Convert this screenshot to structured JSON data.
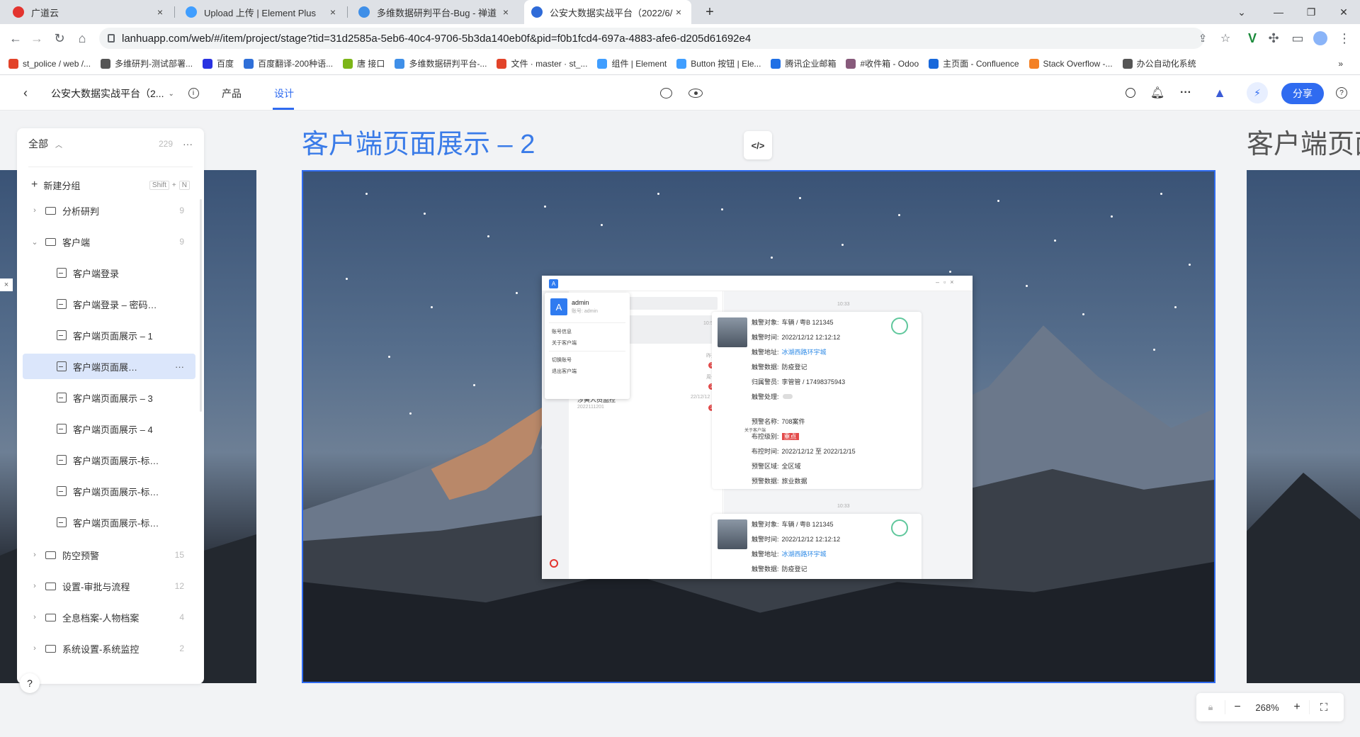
{
  "browser": {
    "tabs": [
      {
        "title": "广道云",
        "color": "#e3342f"
      },
      {
        "title": "Upload 上传 | Element Plus",
        "color": "#409eff"
      },
      {
        "title": "多维数据研判平台-Bug - 禅道",
        "color": "#3f8fe8"
      },
      {
        "title": "公安大数据实战平台（2022/6/1…",
        "color": "#2f6bd8"
      }
    ],
    "new_tab": "+",
    "url": "lanhuapp.com/web/#/item/project/stage?tid=31d2585a-5eb6-40c4-9706-5b3da140eb0f&pid=f0b1fcd4-697a-4883-afe6-d205d61692e4",
    "bookmarks": [
      {
        "label": "st_police / web /...",
        "color": "#e24329"
      },
      {
        "label": "多维研判-测试部署...",
        "color": "#555555"
      },
      {
        "label": "百度",
        "color": "#2932e1"
      },
      {
        "label": "百度翻译-200种语...",
        "color": "#2f6fd8"
      },
      {
        "label": "唐 接口",
        "color": "#7cb518"
      },
      {
        "label": "多维数据研判平台-...",
        "color": "#3f8fe8"
      },
      {
        "label": "文件 · master · st_...",
        "color": "#e24329"
      },
      {
        "label": "组件 | Element",
        "color": "#409eff"
      },
      {
        "label": "Button 按钮 | Ele...",
        "color": "#409eff"
      },
      {
        "label": "腾讯企业邮箱",
        "color": "#1f6fe5"
      },
      {
        "label": "#收件箱 - Odoo",
        "color": "#875a7b"
      },
      {
        "label": "主页面 - Confluence",
        "color": "#1868db"
      },
      {
        "label": "Stack Overflow -...",
        "color": "#f48024"
      },
      {
        "label": "办公自动化系统",
        "color": "#555555"
      }
    ],
    "more_bookmarks": "»"
  },
  "header": {
    "project_name": "公安大数据实战平台（2...",
    "tabs": [
      "产品",
      "设计"
    ],
    "active_tab": "设计",
    "share_label": "分享",
    "accent": "#2f6bf0"
  },
  "sidebar": {
    "filter_label": "全部",
    "total": "229",
    "more": "···",
    "new_group": "新建分组",
    "shortcut": [
      "Shift",
      "+",
      "N"
    ],
    "groups_top": [
      {
        "label": "分析研判",
        "count": "9",
        "expanded": false
      },
      {
        "label": "客户端",
        "count": "9",
        "expanded": true
      }
    ],
    "items": [
      "客户端登录",
      "客户端登录 – 密码…",
      "客户端页面展示 – 1",
      "客户端页面展…",
      "客户端页面展示 – 3",
      "客户端页面展示 – 4",
      "客户端页面展示-标…",
      "客户端页面展示-标…",
      "客户端页面展示-标…"
    ],
    "active_index": 3,
    "groups_bottom": [
      {
        "label": "防空预警",
        "count": "15"
      },
      {
        "label": "设置-审批与流程",
        "count": "12"
      },
      {
        "label": "全息档案-人物档案",
        "count": "4"
      },
      {
        "label": "系统设置-系统监控",
        "count": "2"
      }
    ],
    "help": "?"
  },
  "canvas": {
    "frame_title": "客户端页面展示 – 2",
    "next_frame_title": "客户端页面",
    "code_button": "</>",
    "zoom": "268%",
    "zoom_out": "−",
    "zoom_in": "+"
  },
  "inner_app": {
    "logo": "A",
    "user": {
      "avatar": "A",
      "name": "admin",
      "account": "账号: admin"
    },
    "menu": [
      "账号信息",
      "关于客户端",
      "切换账号",
      "退出客户端"
    ],
    "list": [
      {
        "title": "",
        "time": "10:53",
        "badge": ""
      },
      {
        "title": "",
        "time": "昨天",
        "badge": "2"
      },
      {
        "title": "",
        "time": "周一",
        "badge": "2"
      },
      {
        "title": "涉黄人员监控",
        "sub": "2022111201",
        "time": "22/12/12",
        "badge": "2"
      }
    ],
    "time_divider": "10:33",
    "cards": [
      {
        "fields": [
          {
            "k": "触警对象:",
            "v": "车辆 / 粤B 121345"
          },
          {
            "k": "触警时间:",
            "v": "2022/12/12 12:12:12"
          },
          {
            "k": "触警地址:",
            "v": "冰湖西路环宇城",
            "link": true
          },
          {
            "k": "触警数据:",
            "v": "防疫登记"
          },
          {
            "k": "归属警员:",
            "v": "李管管 / 17498375943"
          },
          {
            "k": "触警处理:",
            "v": ""
          }
        ],
        "fields2": [
          {
            "k": "预警名称:",
            "v": "708案件"
          },
          {
            "k": "布控级别:",
            "v": "重点",
            "tag": true
          },
          {
            "k": "布控时间:",
            "v": "2022/12/12  至  2022/12/15"
          },
          {
            "k": "预警区域:",
            "v": "全区域"
          },
          {
            "k": "预警数据:",
            "v": "旅业数据"
          }
        ],
        "tooltip": "关于客户端"
      },
      {
        "fields": [
          {
            "k": "触警对象:",
            "v": "车辆 / 粤B 121345"
          },
          {
            "k": "触警时间:",
            "v": "2022/12/12 12:12:12"
          },
          {
            "k": "触警地址:",
            "v": "冰湖西路环宇城",
            "link": true
          },
          {
            "k": "触警数据:",
            "v": "防疫登记"
          }
        ]
      }
    ]
  }
}
